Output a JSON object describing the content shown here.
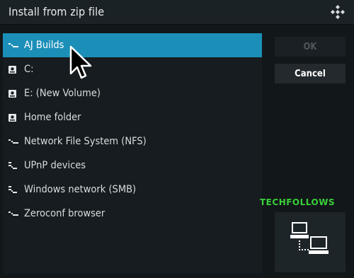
{
  "dialog": {
    "title": "Install from zip file"
  },
  "sources": [
    {
      "label": "AJ Builds",
      "icon": "network-icon",
      "focused": true
    },
    {
      "label": "C:",
      "icon": "drive-icon"
    },
    {
      "label": "E: (New Volume)",
      "icon": "drive-icon"
    },
    {
      "label": "Home folder",
      "icon": "drive-icon"
    },
    {
      "label": "Network File System (NFS)",
      "icon": "network-icon"
    },
    {
      "label": "UPnP devices",
      "icon": "upnp-icon"
    },
    {
      "label": "Windows network (SMB)",
      "icon": "smb-icon"
    },
    {
      "label": "Zeroconf browser",
      "icon": "network-icon"
    }
  ],
  "buttons": {
    "ok_label": "OK",
    "cancel_label": "Cancel"
  },
  "watermark": "TECHFOLLOWS",
  "colors": {
    "focus": "#1c8fb9",
    "watermark": "#3ad03a",
    "background": "#121719"
  }
}
